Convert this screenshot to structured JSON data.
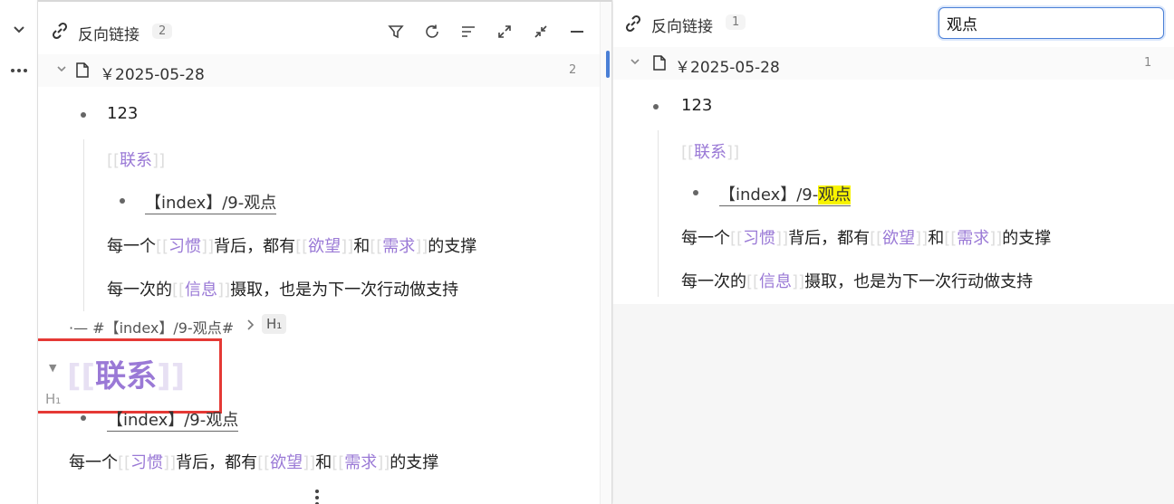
{
  "left_panel": {
    "title": "反向链接",
    "count": "2",
    "doc": {
      "name": "￥2025-05-28",
      "count": "2"
    },
    "list": {
      "item1": "123",
      "ref_title": "联系",
      "link": "【index】/9-观点",
      "line1": {
        "pre": "每一个",
        "a": "习惯",
        "mid": "背后，都有",
        "b": "欲望",
        "and": "和",
        "c": "需求",
        "post": "的支撑"
      },
      "line2": {
        "pre": "每一次的",
        "a": "信息",
        "post": "摄取，也是为下一次行动做支持"
      }
    },
    "breadcrumb": {
      "text": "#【index】/9-观点#",
      "badge": "H₁"
    },
    "heading": {
      "text": "联系",
      "level": "H₁"
    },
    "below": {
      "link": "【index】/9-观点",
      "line1": {
        "pre": "每一个",
        "a": "习惯",
        "mid": "背后，都有",
        "b": "欲望",
        "and": "和",
        "c": "需求",
        "post": "的支撑"
      }
    }
  },
  "right_panel": {
    "title": "反向链接",
    "count": "1",
    "search_value": "观点",
    "doc": {
      "name": "￥2025-05-28",
      "count": "1"
    },
    "list": {
      "item1": "123",
      "ref_title": "联系",
      "link_pre": "【index】/9-",
      "link_hl": "观点",
      "line1": {
        "pre": "每一个",
        "a": "习惯",
        "mid": "背后，都有",
        "b": "欲望",
        "and": "和",
        "c": "需求",
        "post": "的支撑"
      },
      "line2": {
        "pre": "每一次的",
        "a": "信息",
        "post": "摄取，也是为下一次行动做支持"
      }
    }
  },
  "colors": {
    "link": "#9a79d6",
    "highlight": "#f7f300",
    "focus": "#4a7fd6",
    "annotation": "#e53935"
  }
}
